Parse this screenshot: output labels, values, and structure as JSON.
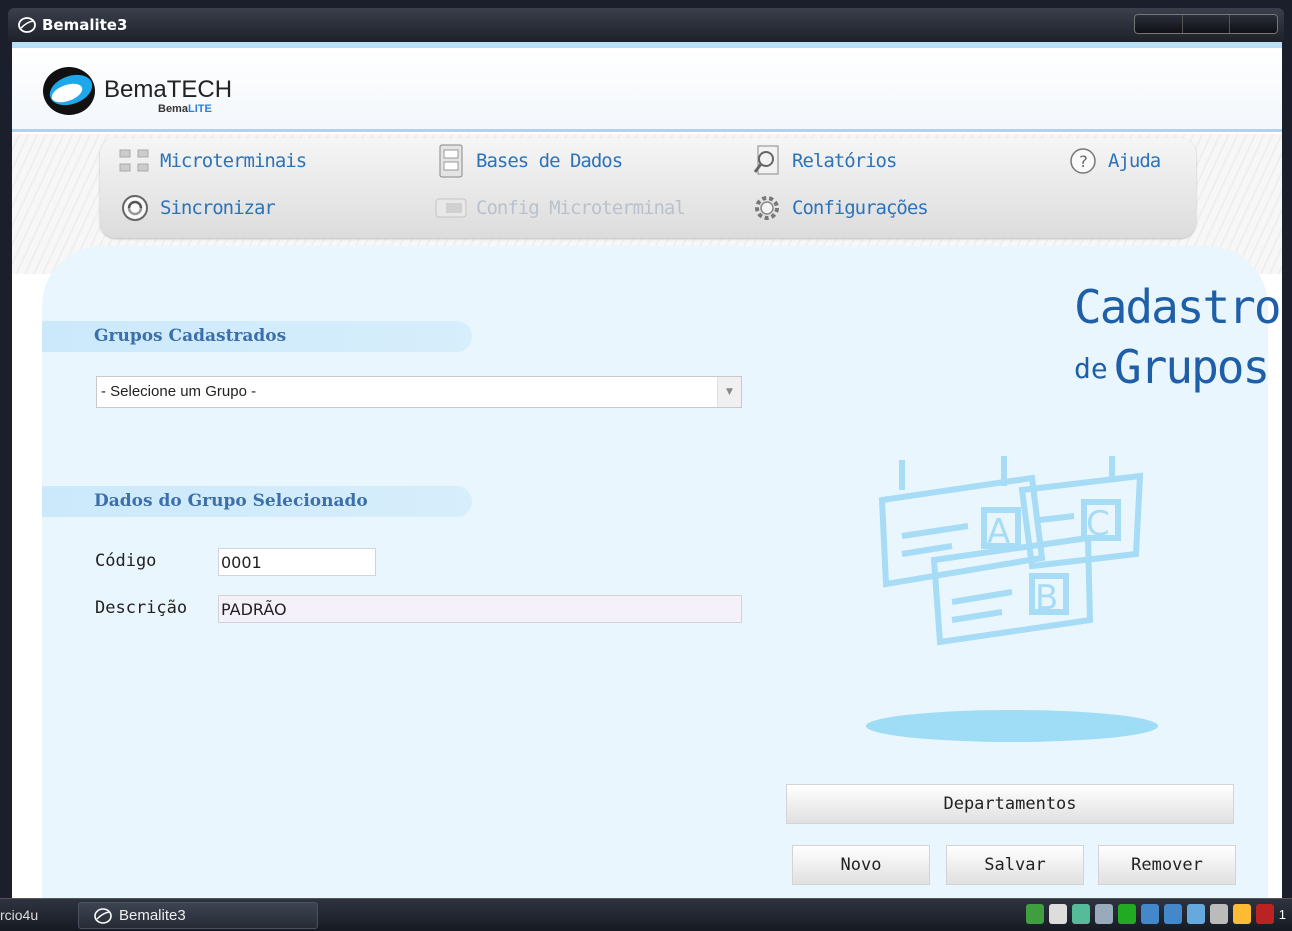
{
  "window": {
    "title": "Bemalite3"
  },
  "brand": {
    "name": "BemaTECH",
    "sub_prefix": "Bema",
    "sub_suffix": "LITE"
  },
  "menu": {
    "microterminais": "Microterminais",
    "bases_de_dados": "Bases de Dados",
    "relatorios": "Relatórios",
    "ajuda": "Ajuda",
    "sincronizar": "Sincronizar",
    "config_microterminal": "Config Microterminal",
    "configuracoes": "Configurações"
  },
  "page": {
    "title_line1": "Cadastro",
    "title_de": "de",
    "title_line2": "Grupos"
  },
  "groups": {
    "section_title": "Grupos Cadastrados",
    "select_value": "- Selecione um Grupo -"
  },
  "details": {
    "section_title": "Dados do Grupo Selecionado",
    "codigo_label": "Código",
    "codigo_value": "0001",
    "descricao_label": "Descrição",
    "descricao_value": "PADRÃO"
  },
  "illustration": {
    "letter_a": "A",
    "letter_b": "B",
    "letter_c": "C"
  },
  "buttons": {
    "departamentos": "Departamentos",
    "novo": "Novo",
    "salvar": "Salvar",
    "remover": "Remover"
  },
  "taskbar": {
    "left_text": "rcio4u",
    "task_label": "Bemalite3",
    "tray_number": "1"
  },
  "colors": {
    "accent": "#2d73b9",
    "panel": "#eaf6fd",
    "title_blue": "#1f5fa8"
  }
}
